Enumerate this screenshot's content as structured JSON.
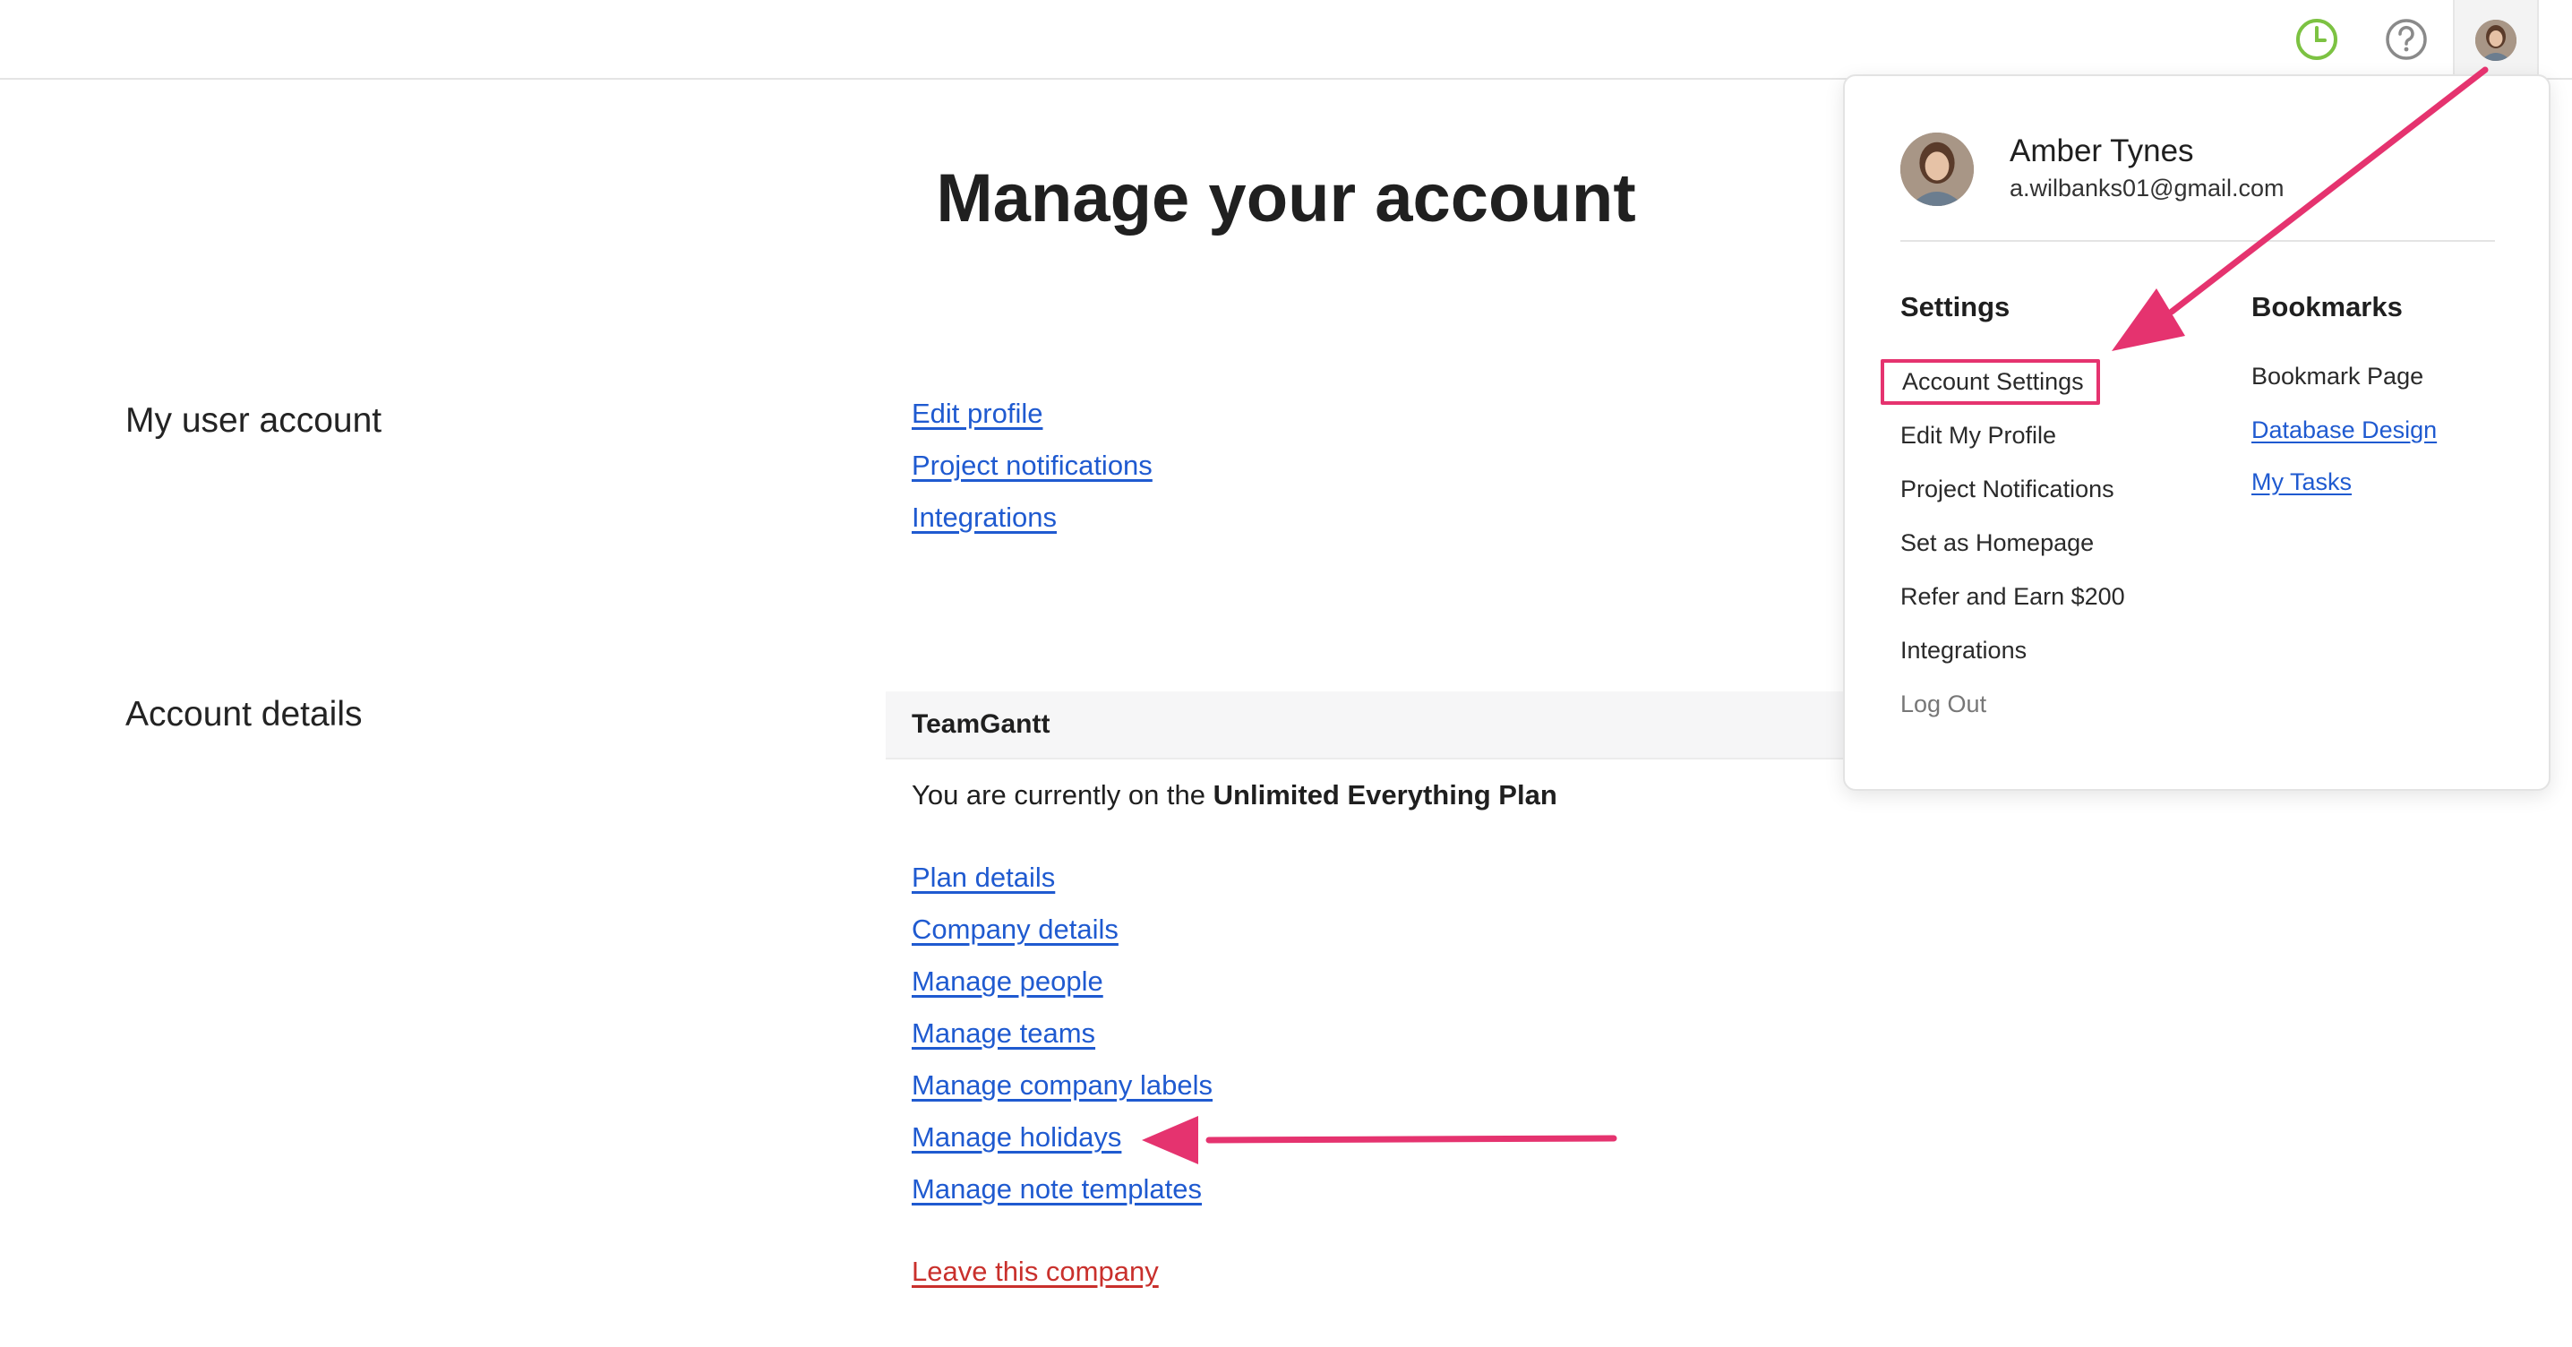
{
  "header": {
    "timer_icon": "clock-icon",
    "help_icon": "question-circle-icon",
    "avatar_icon": "user-avatar-icon",
    "colors": {
      "timer": "#7cc242",
      "help": "#8a8a8a"
    }
  },
  "main": {
    "title": "Manage your account",
    "user_account": {
      "label": "My user account",
      "links": [
        "Edit profile",
        "Project notifications",
        "Integrations"
      ]
    },
    "account_details": {
      "label": "Account details",
      "company_name": "TeamGantt",
      "plan_prefix": "You are currently on the ",
      "plan_name": "Unlimited Everything Plan",
      "links": [
        "Plan details",
        "Company details",
        "Manage people",
        "Manage teams",
        "Manage company labels",
        "Manage holidays",
        "Manage note templates"
      ],
      "leave_link": "Leave this company"
    }
  },
  "dropdown": {
    "user_name": "Amber Tynes",
    "user_email": "a.wilbanks01@gmail.com",
    "settings": {
      "heading": "Settings",
      "items": [
        "Account Settings",
        "Edit My Profile",
        "Project Notifications",
        "Set as Homepage",
        "Refer and Earn $200",
        "Integrations",
        "Log Out"
      ]
    },
    "bookmarks": {
      "heading": "Bookmarks",
      "items": [
        "Bookmark Page",
        "Database Design",
        "My Tasks"
      ]
    }
  },
  "colors": {
    "link": "#1f5ad0",
    "danger": "#c9302c",
    "annotation": "#e5336f"
  }
}
